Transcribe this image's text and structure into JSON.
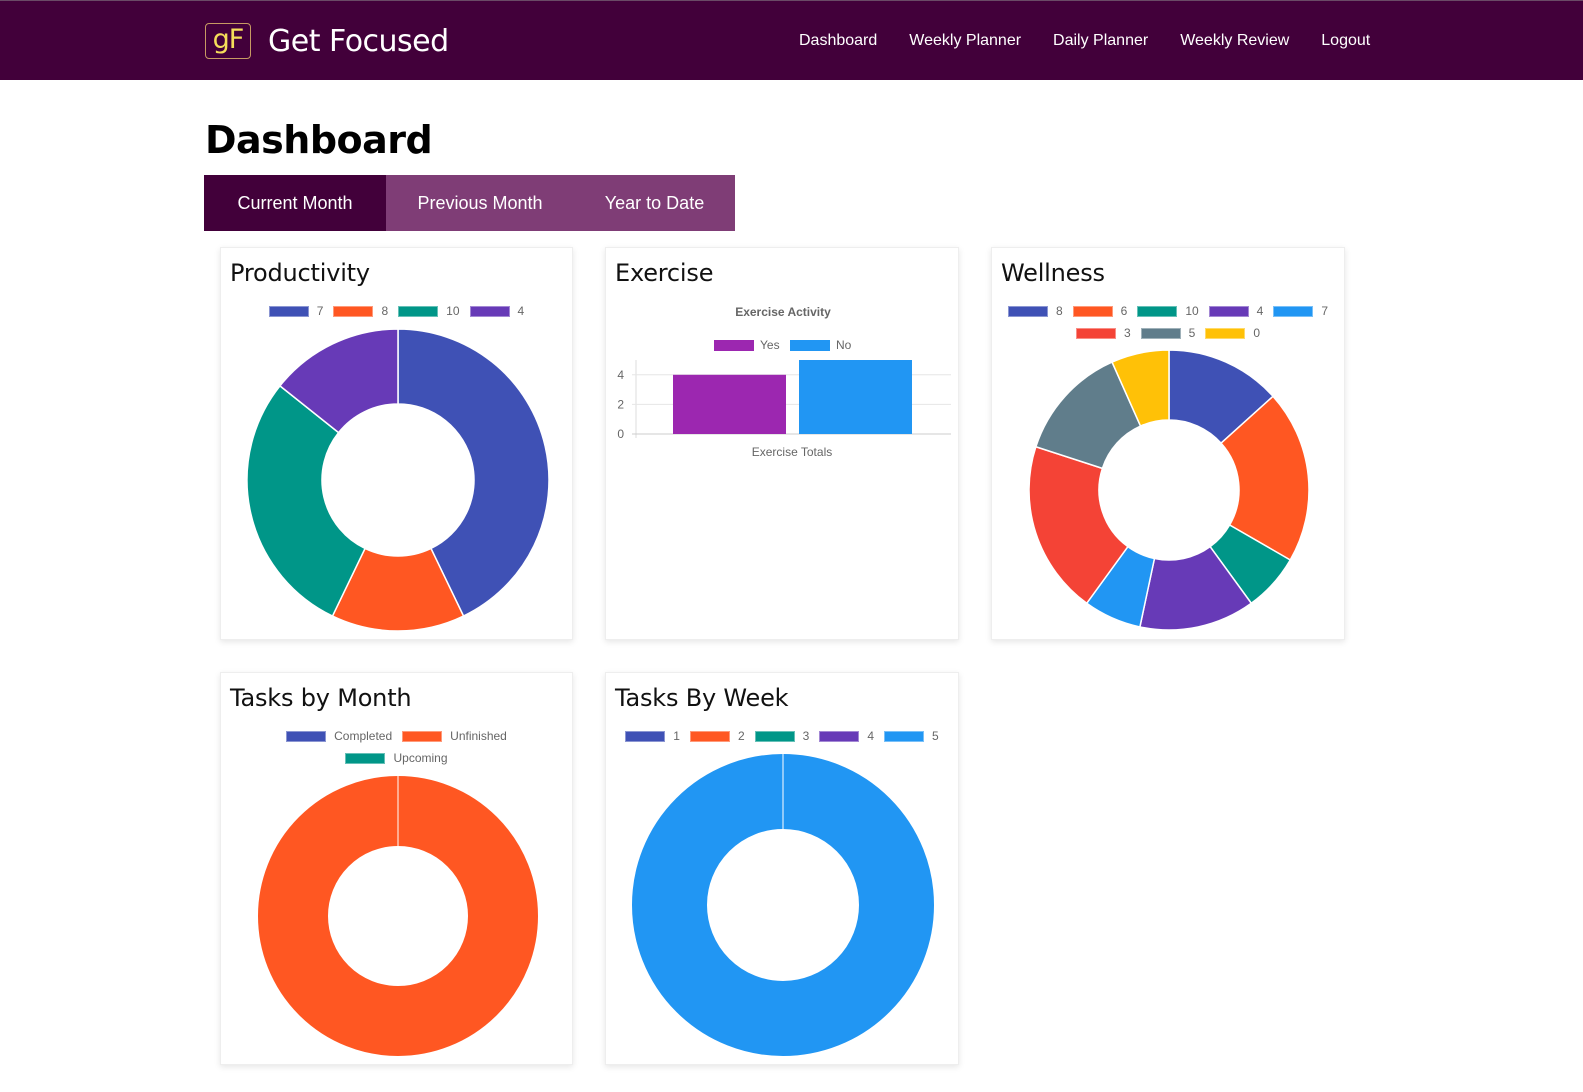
{
  "header": {
    "logo_text": "gF",
    "app_name": "Get Focused",
    "nav": [
      "Dashboard",
      "Weekly Planner",
      "Daily Planner",
      "Weekly Review",
      "Logout"
    ]
  },
  "page": {
    "title": "Dashboard",
    "tabs": [
      {
        "label": "Current Month",
        "active": true
      },
      {
        "label": "Previous Month",
        "active": false
      },
      {
        "label": "Year to Date",
        "active": false
      }
    ]
  },
  "colors": {
    "navbar": "#42003a",
    "tab_active": "#42003a",
    "tab_inactive": "#7f3d76"
  },
  "chart_data": [
    {
      "id": "productivity",
      "type": "pie",
      "variant": "doughnut",
      "title": "Productivity",
      "labels": [
        "7",
        "8",
        "10",
        "4"
      ],
      "values": [
        3,
        1,
        2,
        1
      ],
      "colors": [
        "#3f51b5",
        "#ff5722",
        "#009688",
        "#673ab7"
      ],
      "legend": "top"
    },
    {
      "id": "exercise",
      "type": "bar",
      "title": "Exercise",
      "subtitle": "Exercise Activity",
      "categories": [
        "Exercise Totals"
      ],
      "series": [
        {
          "name": "Yes",
          "values": [
            4
          ],
          "color": "#9c27b0"
        },
        {
          "name": "No",
          "values": [
            5
          ],
          "color": "#2196f3"
        }
      ],
      "yticks": [
        "0",
        "2",
        "4"
      ],
      "ylim": [
        0,
        5
      ],
      "xlabel": "Exercise Totals",
      "grid": true,
      "legend": "top"
    },
    {
      "id": "wellness",
      "type": "pie",
      "variant": "doughnut",
      "title": "Wellness",
      "labels": [
        "8",
        "6",
        "10",
        "4",
        "7",
        "3",
        "5",
        "0"
      ],
      "values": [
        2,
        3,
        1,
        2,
        1,
        3,
        2,
        1
      ],
      "colors": [
        "#3f51b5",
        "#ff5722",
        "#009688",
        "#673ab7",
        "#2196f3",
        "#f44336",
        "#607d8b",
        "#ffc107"
      ],
      "legend": "top"
    },
    {
      "id": "tasks-month",
      "type": "pie",
      "variant": "doughnut",
      "title": "Tasks by Month",
      "labels": [
        "Completed",
        "Unfinished",
        "Upcoming"
      ],
      "values": [
        0,
        1,
        0
      ],
      "colors": [
        "#3f51b5",
        "#ff5722",
        "#009688"
      ],
      "legend": "top"
    },
    {
      "id": "tasks-week",
      "type": "pie",
      "variant": "doughnut",
      "title": "Tasks By Week",
      "labels": [
        "1",
        "2",
        "3",
        "4",
        "5"
      ],
      "values": [
        0,
        0,
        0,
        0,
        1
      ],
      "colors": [
        "#3f51b5",
        "#ff5722",
        "#009688",
        "#673ab7",
        "#2196f3"
      ],
      "legend": "top"
    }
  ]
}
